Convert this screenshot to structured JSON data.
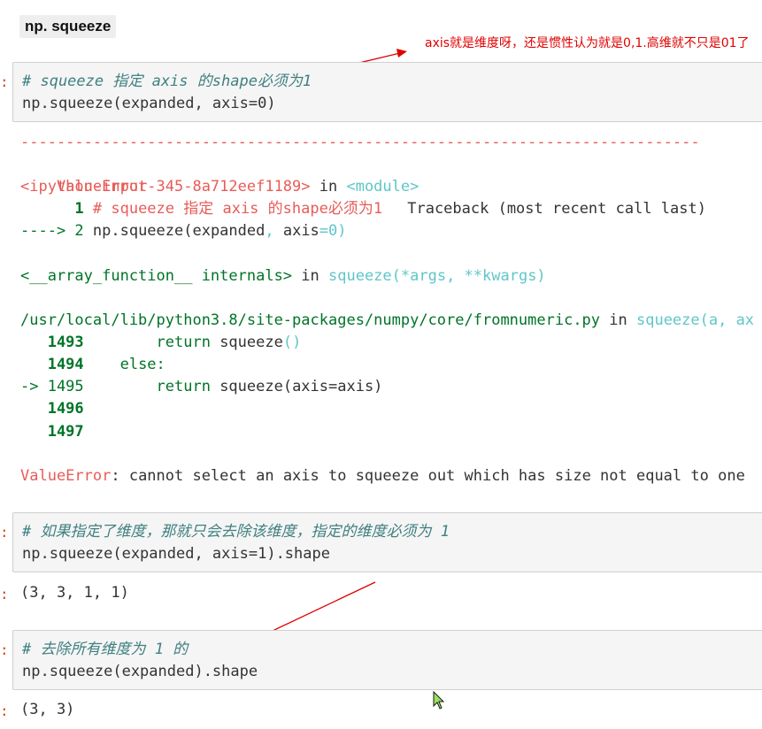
{
  "heading": {
    "text": "np. squeeze"
  },
  "annotation": {
    "text": "axis就是维度呀，还是惯性认为就是0,1.高维就不只是01了"
  },
  "cell1": {
    "prompt": ":",
    "comment": "# squeeze 指定 axis 的shape必须为1",
    "code": "np.squeeze(expanded, axis=0)"
  },
  "traceback": {
    "dashes": "---------------------------------------------------------------------------",
    "error_name": "ValueError",
    "header_right": "Traceback (most recent call last)",
    "input_ref": "<ipython-input-345-8a712eef1189>",
    "in1": " in ",
    "module": "<module>",
    "l1_num": "      1",
    "l1_code": " # squeeze 指定 axis 的shape必须为1",
    "l2_arrow": "----> 2",
    "l2_code_a": " np.squeeze(expanded",
    "l2_code_b": ", ",
    "l2_code_c": "axis",
    "l2_code_d": "=0)",
    "internals": "<__array_function__ internals>",
    "in2": " in ",
    "sq_func": "squeeze(*args",
    "sq_comma": ", ",
    "sq_kw": "**kwargs)",
    "path": "/usr/local/lib/python3.8/site-packages/numpy/core/fromnumeric.py",
    "in3": " in ",
    "sq2": "squeeze(a, ax",
    "n1493": "   1493",
    "c1493a": "        return",
    "c1493b": " squeeze",
    "c1493c": "()",
    "n1494": "   1494",
    "c1494": "    else:",
    "n1495": "-> 1495",
    "c1495a": "        return",
    "c1495b": " squeeze(axis=axis)",
    "n1496": "   1496",
    "n1497": "   1497",
    "err_name2": "ValueError",
    "err_msg": ": cannot select an axis to squeeze out which has size not equal to one"
  },
  "cell2": {
    "prompt": ":",
    "comment": "# 如果指定了维度，那就只会去除该维度，指定的维度必须为 1",
    "code": "np.squeeze(expanded, axis=1).shape",
    "out_prompt": ":",
    "output": "(3, 3, 1, 1)"
  },
  "cell3": {
    "prompt": ":",
    "comment": "# 去除所有维度为 1 的",
    "code": "np.squeeze(expanded).shape",
    "out_prompt": ":",
    "output": "(3, 3)"
  },
  "colors": {
    "annotation": "#e00000",
    "error": "#e75c58",
    "lineno": "#007427",
    "link": "#208ffb"
  }
}
